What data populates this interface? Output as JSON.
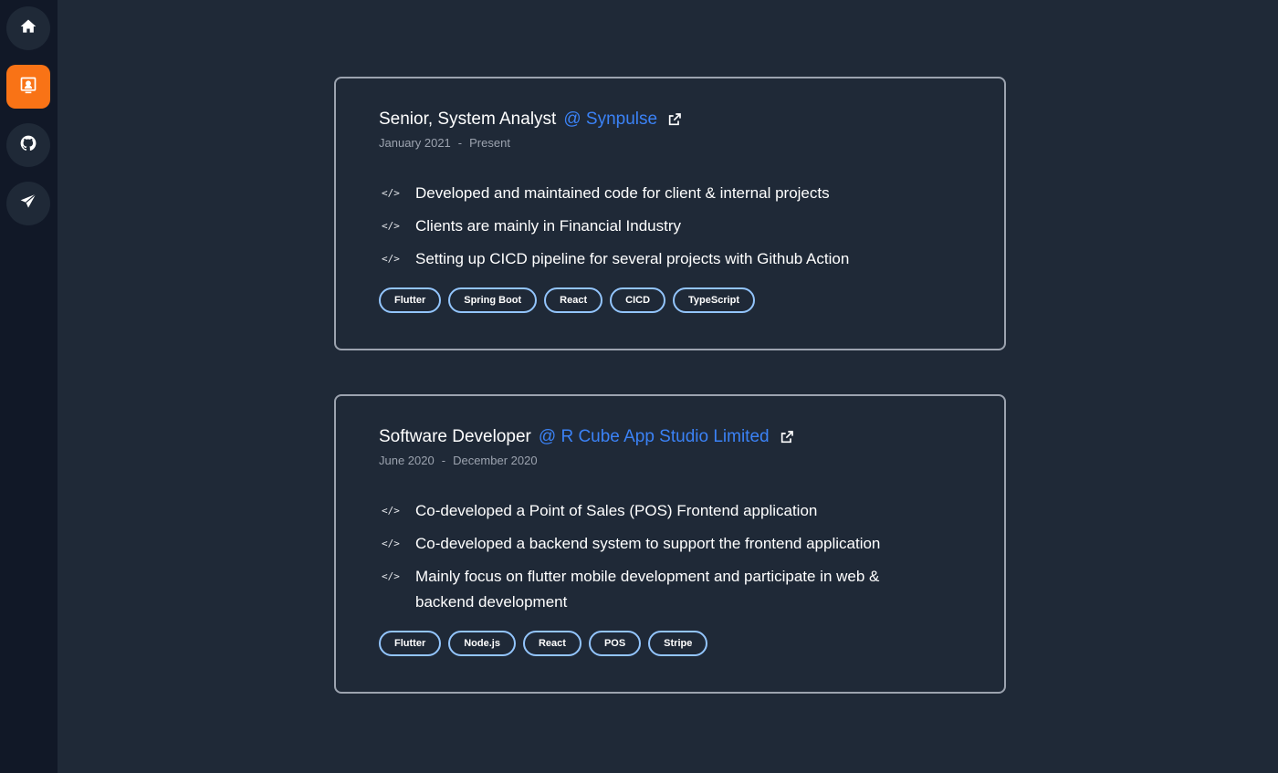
{
  "sidebar": {
    "items": [
      {
        "icon": "home-icon",
        "active": false
      },
      {
        "icon": "presentation-icon",
        "active": true
      },
      {
        "icon": "github-icon",
        "active": false
      },
      {
        "icon": "send-icon",
        "active": false
      }
    ],
    "accent_color": "#f97316"
  },
  "experiences": [
    {
      "role": "Senior, System Analyst",
      "company": "@ Synpulse",
      "start": "January 2021",
      "separator": "-",
      "end": "Present",
      "bullets": [
        "Developed and maintained code for client & internal projects",
        "Clients are mainly in Financial Industry",
        "Setting up CICD pipeline for several projects with Github Action"
      ],
      "tags": [
        "Flutter",
        "Spring Boot",
        "React",
        "CICD",
        "TypeScript"
      ]
    },
    {
      "role": "Software Developer",
      "company": "@ R Cube App Studio Limited",
      "start": "June 2020",
      "separator": "-",
      "end": "December 2020",
      "bullets": [
        "Co-developed a Point of Sales (POS) Frontend application",
        "Co-developed a backend system to support the frontend application",
        "Mainly focus on flutter mobile development and participate in web & backend development"
      ],
      "tags": [
        "Flutter",
        "Node.js",
        "React",
        "POS",
        "Stripe"
      ]
    }
  ],
  "bullet_icon": "</>",
  "colors": {
    "link": "#3b82f6",
    "tag_border": "#93c5fd",
    "card_border": "#9ca3af"
  }
}
